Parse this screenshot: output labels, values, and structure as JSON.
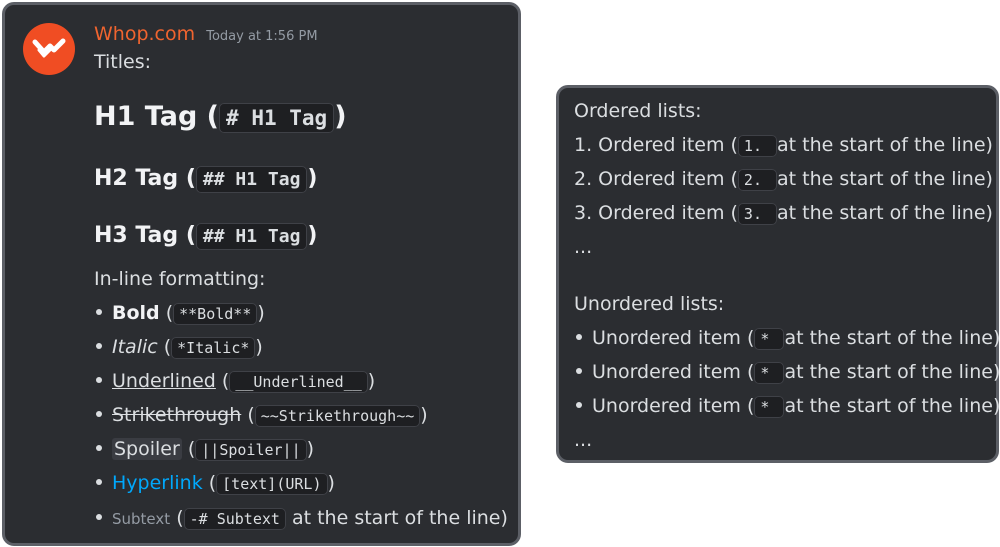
{
  "message": {
    "author": "Whop.com",
    "timestamp": "Today at 1:56 PM",
    "titles_label": "Titles:",
    "h1": {
      "text": "H1 Tag",
      "code": "# H1 Tag"
    },
    "h2": {
      "text": "H2 Tag",
      "code": "## H1 Tag"
    },
    "h3": {
      "text": "H3 Tag",
      "code": "## H1 Tag"
    },
    "inline_label": "In-line formatting:",
    "inline": {
      "bold": {
        "text": "Bold",
        "code": "**Bold**"
      },
      "italic": {
        "text": "Italic",
        "code": "*Italic*"
      },
      "underline": {
        "text": "Underlined",
        "code": "__Underlined__"
      },
      "strike": {
        "text": "Strikethrough",
        "code": "~~Strikethrough~~"
      },
      "spoiler": {
        "text": "Spoiler",
        "code": "||Spoiler||"
      },
      "hyperlink": {
        "text": "Hyperlink",
        "code": "[text](URL)"
      },
      "subtext": {
        "text": "Subtext",
        "code": "-# Subtext",
        "suffix": "at the start of the line)"
      }
    }
  },
  "lists": {
    "ordered_label": "Ordered lists:",
    "ordered": [
      {
        "prefix": "1. Ordered item (",
        "code": "1. ",
        "suffix": "at the start of the line)"
      },
      {
        "prefix": "2. Ordered item (",
        "code": "2. ",
        "suffix": "at the start of the line)"
      },
      {
        "prefix": "3. Ordered item (",
        "code": "3. ",
        "suffix": "at the start of the line)"
      }
    ],
    "ordered_more": "...",
    "unordered_label": "Unordered lists:",
    "unordered": [
      {
        "prefix": "Unordered item (",
        "code": "* ",
        "suffix": "at the start of the line)"
      },
      {
        "prefix": "Unordered item (",
        "code": "* ",
        "suffix": "at the start of the line)"
      },
      {
        "prefix": "Unordered item (",
        "code": "* ",
        "suffix": "at the start of the line)"
      }
    ],
    "unordered_more": "..."
  },
  "colors": {
    "accent": "#f04d23",
    "link": "#00a8fc",
    "panel": "#2b2d31"
  },
  "icons": {
    "avatar": "whop-logo-icon"
  }
}
